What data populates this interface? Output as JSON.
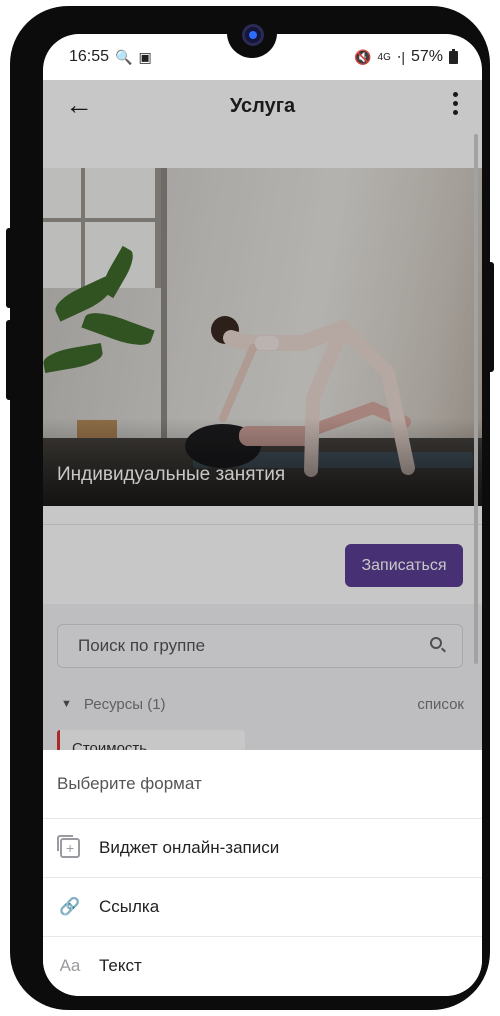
{
  "status_bar": {
    "time": "16:55",
    "network": "4G",
    "battery": "57%"
  },
  "appbar": {
    "title": "Услуга"
  },
  "hero": {
    "caption": "Индивидуальные занятия"
  },
  "book_button": {
    "label": "Записаться"
  },
  "search": {
    "placeholder": "Поиск по группе"
  },
  "resources": {
    "label": "Ресурсы (1)",
    "view_toggle": "список",
    "cost_card": "Стоимость"
  },
  "sheet": {
    "title": "Выберите формат",
    "items": [
      {
        "icon": "widget-icon",
        "label": "Виджет онлайн-записи"
      },
      {
        "icon": "link-icon",
        "label": "Ссылка"
      },
      {
        "icon": "text-icon",
        "glyph": "Aa",
        "label": "Текст"
      }
    ]
  },
  "colors": {
    "accent": "#5b3f95",
    "cost_marker": "#dd3333"
  }
}
